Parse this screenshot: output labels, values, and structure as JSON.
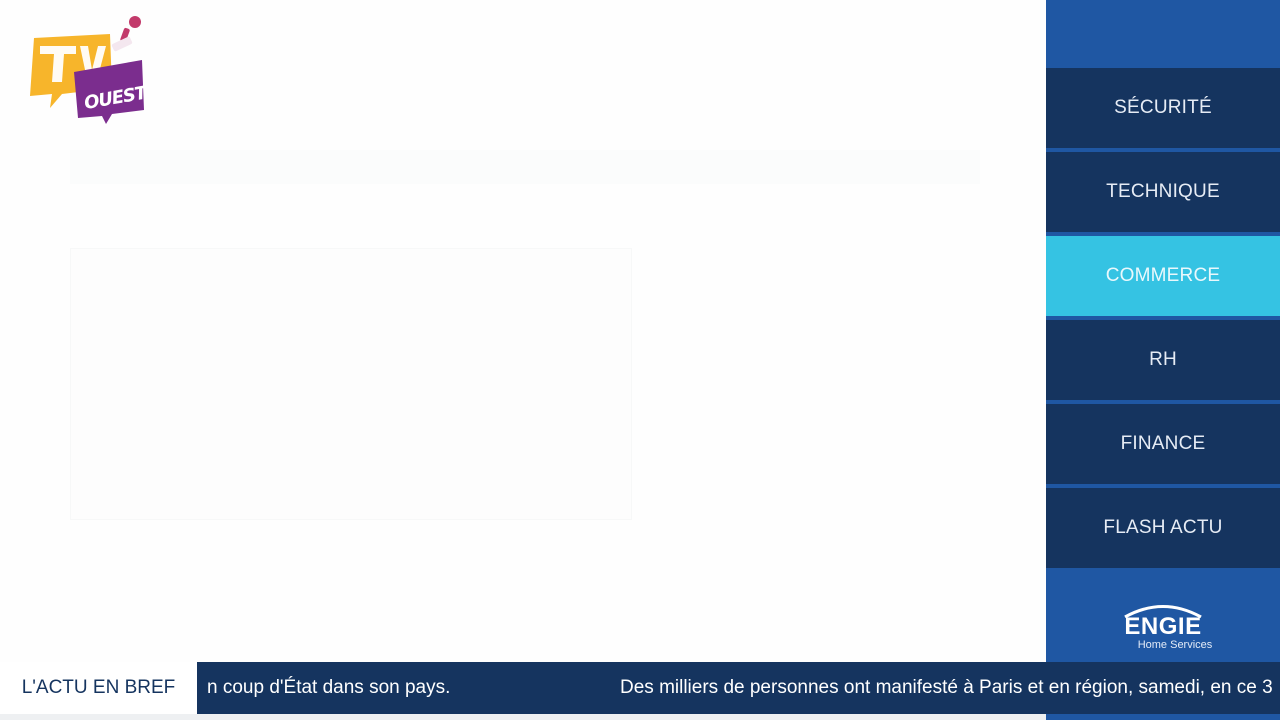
{
  "logo": {
    "word": "OUEST",
    "colors": {
      "yellow": "#f7b52b",
      "purple": "#7b2d8e",
      "pink": "#c23a6b"
    }
  },
  "sidebar": {
    "items": [
      {
        "label": "SÉCURITÉ",
        "active": false
      },
      {
        "label": "TECHNIQUE",
        "active": false
      },
      {
        "label": "COMMERCE",
        "active": true
      },
      {
        "label": "RH",
        "active": false
      },
      {
        "label": "FINANCE",
        "active": false
      },
      {
        "label": "FLASH ACTU",
        "active": false
      }
    ],
    "brand": {
      "name": "ENGIE",
      "subtitle": "Home Services"
    },
    "colors": {
      "background": "#1f57a3",
      "item": "#15345f",
      "active": "#35c3e3"
    }
  },
  "ticker": {
    "label": "L'ACTU EN BREF",
    "items": [
      "n coup d'État dans son pays.",
      "Des milliers de personnes ont manifesté à Paris et en région, samedi, en ce 3"
    ]
  }
}
